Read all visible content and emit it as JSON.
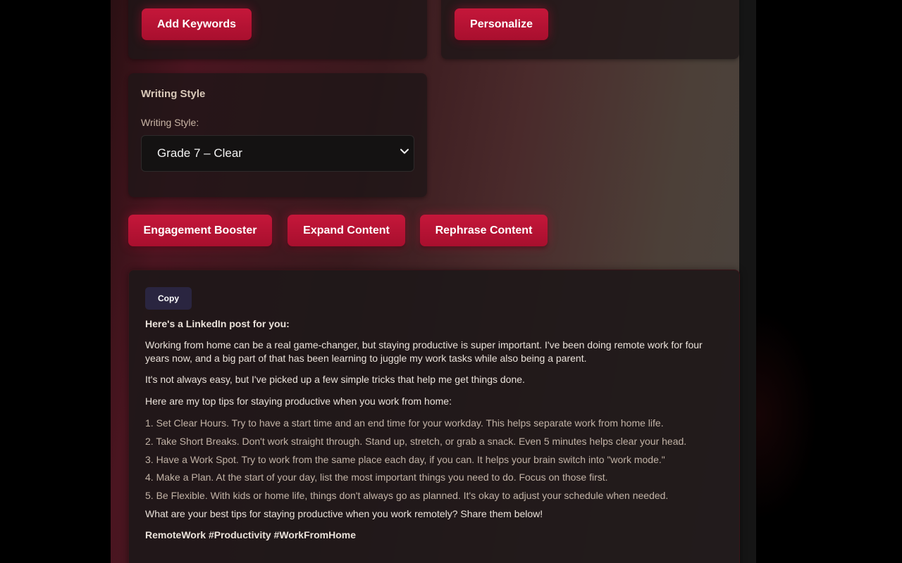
{
  "actions_top": {
    "add_keywords": "Add Keywords",
    "personalize": "Personalize"
  },
  "writing_style": {
    "section_title": "Writing Style",
    "field_label": "Writing Style:",
    "selected": "Grade 7 – Clear"
  },
  "content_actions": {
    "engagement_booster": "Engagement Booster",
    "expand_content": "Expand Content",
    "rephrase_content": "Rephrase Content"
  },
  "output": {
    "copy_label": "Copy",
    "intro": "Here's a LinkedIn post for you:",
    "paragraphs": [
      "Working from home can be a real game-changer, but staying productive is super important. I've been doing remote work for four years now, and a big part of that has been learning to juggle my work tasks while also being a parent.",
      "It's not always easy, but I've picked up a few simple tricks that help me get things done.",
      "Here are my top tips for staying productive when you work from home:"
    ],
    "tips": [
      "1. Set Clear Hours. Try to have a start time and an end time for your workday. This helps separate work from home life.",
      "2. Take Short Breaks. Don't work straight through. Stand up, stretch, or grab a snack. Even 5 minutes helps clear your head.",
      "3. Have a Work Spot. Try to work from the same place each day, if you can. It helps your brain switch into \"work mode.\"",
      "4. Make a Plan. At the start of your day, list the most important things you need to do. Focus on those first.",
      "5. Be Flexible. With kids or home life, things don't always go as planned. It's okay to adjust your schedule when needed."
    ],
    "closing": "What are your best tips for staying productive when you work remotely? Share them below!",
    "hashtags": "RemoteWork #Productivity #WorkFromHome"
  },
  "colors": {
    "accent": "#c5173a",
    "copy_button": "#2a2540",
    "panel": "#1e1617"
  },
  "icons": {
    "select_arrow": "chevron-down-icon"
  }
}
